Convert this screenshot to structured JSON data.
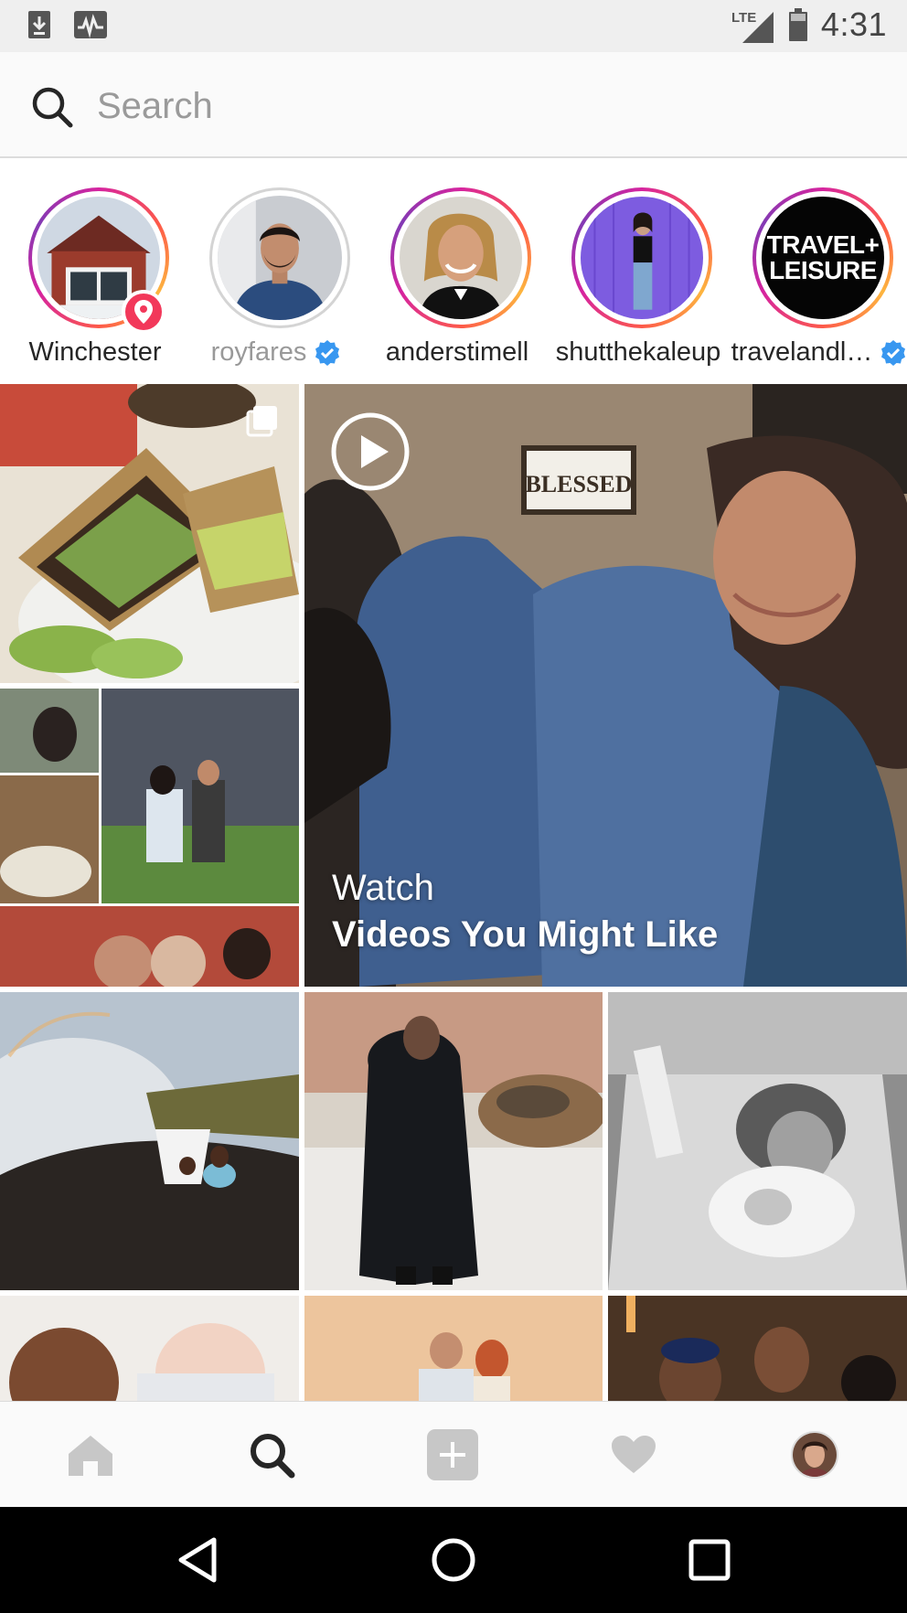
{
  "status_bar": {
    "time": "4:31",
    "network": "LTE",
    "left_icons": [
      "download-icon",
      "activity-icon"
    ]
  },
  "search": {
    "placeholder": "Search"
  },
  "stories": [
    {
      "label": "Winchester",
      "state": "unseen",
      "verified": false,
      "location": true
    },
    {
      "label": "royfares",
      "state": "seen",
      "verified": true,
      "location": false
    },
    {
      "label": "anderstimell",
      "state": "unseen",
      "verified": false,
      "location": false
    },
    {
      "label": "shutthekaleup",
      "state": "unseen",
      "verified": false,
      "location": false
    },
    {
      "label": "travelandl…",
      "state": "unseen",
      "verified": true,
      "location": false
    }
  ],
  "travel_logo": {
    "line1": "TRAVEL+",
    "line2": "LEISURE"
  },
  "video_tile": {
    "line1": "Watch",
    "line2": "Videos You Might Like",
    "sign_text": "BLESSED"
  },
  "nav": {
    "items": [
      "home-icon",
      "search-icon",
      "add-icon",
      "heart-icon",
      "profile-avatar"
    ],
    "active": "search-icon"
  },
  "colors": {
    "verified_blue": "#3897f0",
    "location_red": "#f2385a",
    "story_gradient": [
      "#d6249f",
      "#fd5949",
      "#fdb53f"
    ]
  }
}
